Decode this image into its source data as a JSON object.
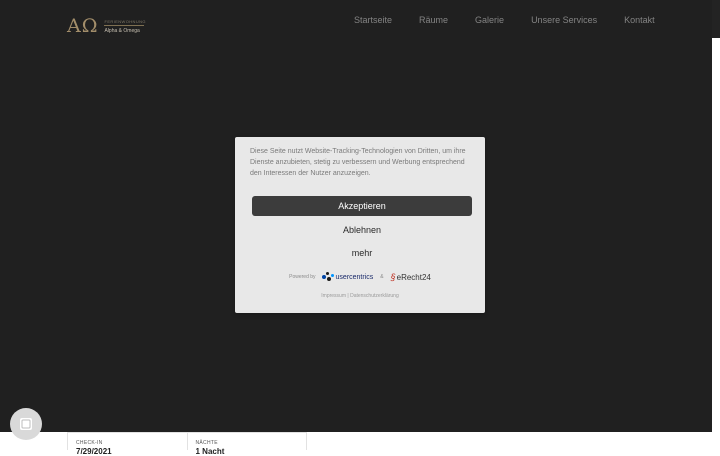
{
  "header": {
    "logo": {
      "mark": "AΩ",
      "tagline": "FERIENWOHNUNG",
      "name": "Alpha & Omega"
    },
    "nav": [
      {
        "label": "Startseite"
      },
      {
        "label": "Räume"
      },
      {
        "label": "Galerie"
      },
      {
        "label": "Unsere Services"
      },
      {
        "label": "Kontakt"
      }
    ]
  },
  "consent": {
    "text": "Diese Seite nutzt Website-Tracking-Technologien von Dritten, um ihre Dienste anzubieten, stetig zu verbessern und Werbung entsprechend den Interessen der Nutzer anzuzeigen.",
    "accept_label": "Akzeptieren",
    "deny_label": "Ablehnen",
    "more_label": "mehr",
    "powered_by": "Powered by",
    "provider1": "usercentrics",
    "amp": "&",
    "provider2": "eRecht24",
    "imprint_label": "Impressum",
    "separator": "|",
    "privacy_label": "Datenschutzerklärung"
  },
  "booking": {
    "checkin_label": "CHECK-IN",
    "checkin_value": "7/29/2021",
    "nights_label": "NÄCHTE",
    "nights_value": "1 Nacht"
  },
  "colors": {
    "background": "#232323",
    "modal_bg": "#e8e8e8",
    "accept_bg": "#3c3c3c",
    "logo_gold": "#b09a73"
  },
  "icons": {
    "privacy_button": "fingerprint-icon"
  }
}
